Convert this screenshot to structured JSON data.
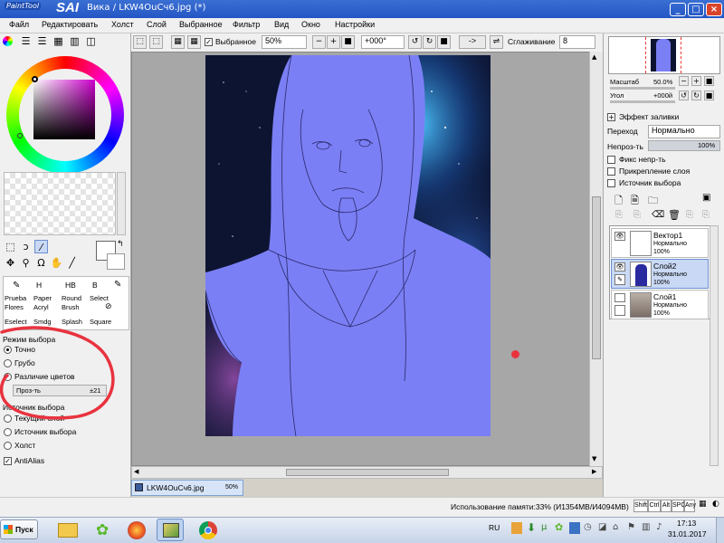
{
  "window": {
    "app_logo_small": "PaintTool",
    "app_logo_big": "SAI",
    "title": "Вика / LKW4OuCч6.jpg (*)",
    "minimize": "_",
    "maximize": "□",
    "close": "×"
  },
  "menu": [
    "Файл",
    "Редактировать",
    "Холст",
    "Слой",
    "Выбранное",
    "Фильтр",
    "Вид",
    "Окно",
    "Настройки"
  ],
  "toolbar": {
    "selection_label": "Выбранное",
    "zoom": "50%",
    "angle": "+000°",
    "flip_arrow": "->",
    "smoothing_label": "Сглаживание",
    "smoothing_value": "8"
  },
  "tools": {
    "brushes": [
      {
        "top": "Prueba",
        "bottom": "Flores"
      },
      {
        "top": "Paper",
        "bottom": "Acryl"
      },
      {
        "top": "Round",
        "bottom": "Brush"
      },
      {
        "top": "Select",
        "bottom": ""
      },
      {
        "top": "Eselect",
        "bottom": ""
      },
      {
        "top": "Smdg",
        "bottom": ""
      },
      {
        "top": "Splash",
        "bottom": ""
      },
      {
        "top": "Square",
        "bottom": ""
      }
    ],
    "row1_labels": [
      "H",
      "HB",
      "B"
    ]
  },
  "selection_mode": {
    "title": "Режим выбора",
    "options": [
      "Точно",
      "Грубо",
      "Различие цветов"
    ],
    "selected": "Точно",
    "tolerance_label": "Проз-ть",
    "tolerance_value": "±21"
  },
  "selection_source": {
    "title": "Источник выбора",
    "options": [
      "Текущий слой",
      "Источник выбора",
      "Холст"
    ],
    "antialias_label": "AntiAlias"
  },
  "navigator": {
    "zoom_label": "Масштаб",
    "zoom_value": "50.0%",
    "angle_label": "Угол",
    "angle_value": "+000й"
  },
  "layer_props": {
    "fill_effect": "Эффект заливки",
    "blend_label": "Переход",
    "blend_value": "Нормально",
    "opacity_label": "Непроз-ть",
    "opacity_value": "100%",
    "checkboxes": [
      "Фикс непр-ть",
      "Прикрепление слоя",
      "Источник выбора"
    ]
  },
  "layers": [
    {
      "name": "Вектор1",
      "mode": "Нормально",
      "opacity": "100%"
    },
    {
      "name": "Слой2",
      "mode": "Нормально",
      "opacity": "100%"
    },
    {
      "name": "Слой1",
      "mode": "Нормально",
      "opacity": "100%"
    }
  ],
  "document_tab": {
    "name": "LKW4OuCч6.jpg",
    "zoom": "50%"
  },
  "status": {
    "memory": "Использование памяти:33% (И1354МВ/И4094МВ)",
    "keys": [
      "Shift",
      "Ctrl",
      "Alt",
      "SPC",
      "Any"
    ]
  },
  "taskbar": {
    "start": "Пуск",
    "lang": "RU",
    "time": "17:13",
    "date": "31.01.2017"
  },
  "colors": {
    "figure_fill": "#7b7ff5",
    "annotation_red": "#e8333f",
    "taskbar_bg": "#dbe4f3"
  }
}
